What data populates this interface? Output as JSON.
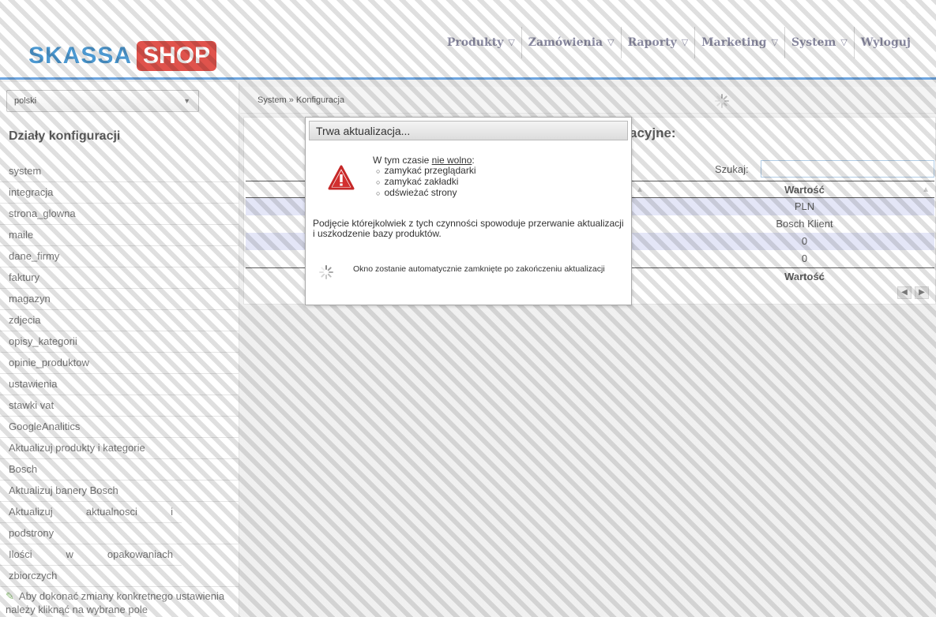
{
  "header": {
    "logo_left": "SKASSA",
    "logo_right": "SHOP",
    "nav": [
      {
        "label": "Produkty",
        "has_dropdown": true
      },
      {
        "label": "Zamówienia",
        "has_dropdown": true
      },
      {
        "label": "Raporty",
        "has_dropdown": true
      },
      {
        "label": "Marketing",
        "has_dropdown": true
      },
      {
        "label": "System",
        "has_dropdown": true
      },
      {
        "label": "Wyloguj",
        "has_dropdown": false
      }
    ]
  },
  "sidebar": {
    "language": "polski",
    "title": "Działy konfiguracji",
    "items": [
      "system",
      "integracja",
      "strona_glowna",
      "maile",
      "dane_firmy",
      "faktury",
      "magazyn",
      "zdjecia",
      "opisy_kategorii",
      "opinie_produktow",
      "ustawienia",
      "stawki vat",
      "GoogleAnalitics",
      "Aktualizuj produkty i kategorie",
      "Bosch",
      "Aktualizuj banery Bosch"
    ],
    "items_justified": [
      [
        "Aktualizuj",
        "aktualnosci",
        "i"
      ],
      [
        "podstrony"
      ],
      [
        "Ilości",
        "w",
        "opakowaniach"
      ],
      [
        "zbiorczych"
      ]
    ],
    "hint": "Aby dokonać zmiany konkretnego ustawienia należy kliknąć na wybrane pole"
  },
  "main": {
    "breadcrumb": "System » Konfiguracja",
    "section_title": "acyjne:",
    "search_label": "Szukaj:",
    "search_value": "",
    "column_header": "Wartość",
    "rows": [
      "PLN",
      "Bosch Klient",
      "0",
      "0"
    ],
    "column_footer": "Wartość",
    "pager": [
      "◀",
      "▶"
    ]
  },
  "modal": {
    "title": "Trwa aktualizacja...",
    "intro_prefix": "W tym czasie ",
    "intro_underlined": "nie wolno",
    "intro_suffix": ":",
    "prohibited": [
      "zamykać przeglądarki",
      "zamykać zakładki",
      "odświeżać strony"
    ],
    "body": "Podjęcie którejkolwiek z tych czynności spowoduje przerwanie aktualizacji i uszkodzenie bazy produktów.",
    "footer": "Okno zostanie automatycznie zamknięte po zakończeniu aktualizacji",
    "colors": {
      "warning_red": "#d32f2f",
      "accent_blue": "#4a90d9"
    }
  }
}
